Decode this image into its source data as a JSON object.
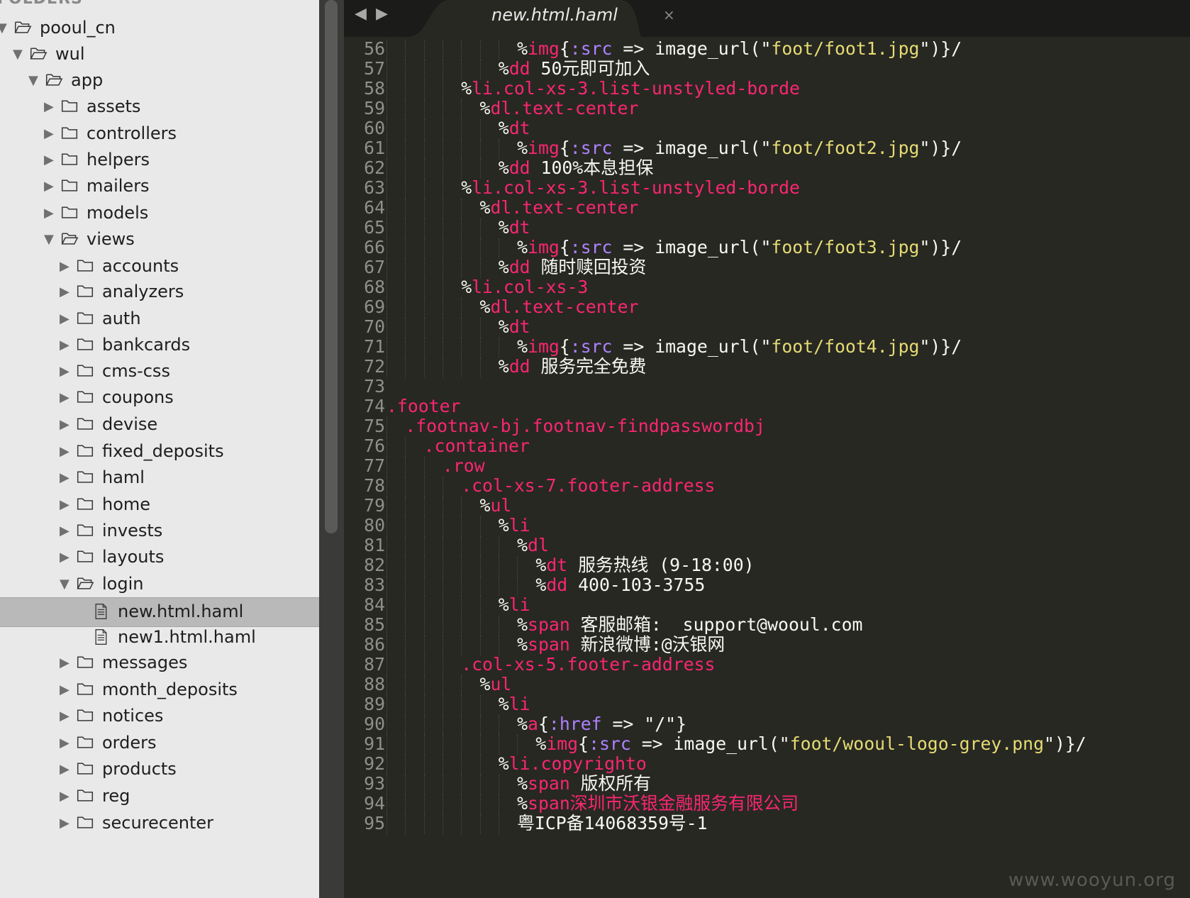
{
  "sidebar": {
    "header": "FOLDERS",
    "items": [
      {
        "label": "pooul_cn",
        "depth": 0,
        "type": "folder",
        "expanded": true
      },
      {
        "label": "wul",
        "depth": 1,
        "type": "folder",
        "expanded": true
      },
      {
        "label": "app",
        "depth": 2,
        "type": "folder",
        "expanded": true
      },
      {
        "label": "assets",
        "depth": 3,
        "type": "folder",
        "expanded": false
      },
      {
        "label": "controllers",
        "depth": 3,
        "type": "folder",
        "expanded": false
      },
      {
        "label": "helpers",
        "depth": 3,
        "type": "folder",
        "expanded": false
      },
      {
        "label": "mailers",
        "depth": 3,
        "type": "folder",
        "expanded": false
      },
      {
        "label": "models",
        "depth": 3,
        "type": "folder",
        "expanded": false
      },
      {
        "label": "views",
        "depth": 3,
        "type": "folder",
        "expanded": true
      },
      {
        "label": "accounts",
        "depth": 4,
        "type": "folder",
        "expanded": false
      },
      {
        "label": "analyzers",
        "depth": 4,
        "type": "folder",
        "expanded": false
      },
      {
        "label": "auth",
        "depth": 4,
        "type": "folder",
        "expanded": false
      },
      {
        "label": "bankcards",
        "depth": 4,
        "type": "folder",
        "expanded": false
      },
      {
        "label": "cms-css",
        "depth": 4,
        "type": "folder",
        "expanded": false
      },
      {
        "label": "coupons",
        "depth": 4,
        "type": "folder",
        "expanded": false
      },
      {
        "label": "devise",
        "depth": 4,
        "type": "folder",
        "expanded": false
      },
      {
        "label": "fixed_deposits",
        "depth": 4,
        "type": "folder",
        "expanded": false
      },
      {
        "label": "haml",
        "depth": 4,
        "type": "folder",
        "expanded": false
      },
      {
        "label": "home",
        "depth": 4,
        "type": "folder",
        "expanded": false
      },
      {
        "label": "invests",
        "depth": 4,
        "type": "folder",
        "expanded": false
      },
      {
        "label": "layouts",
        "depth": 4,
        "type": "folder",
        "expanded": false
      },
      {
        "label": "login",
        "depth": 4,
        "type": "folder",
        "expanded": true
      },
      {
        "label": "new.html.haml",
        "depth": 5,
        "type": "file",
        "selected": true
      },
      {
        "label": "new1.html.haml",
        "depth": 5,
        "type": "file"
      },
      {
        "label": "messages",
        "depth": 4,
        "type": "folder",
        "expanded": false
      },
      {
        "label": "month_deposits",
        "depth": 4,
        "type": "folder",
        "expanded": false
      },
      {
        "label": "notices",
        "depth": 4,
        "type": "folder",
        "expanded": false
      },
      {
        "label": "orders",
        "depth": 4,
        "type": "folder",
        "expanded": false
      },
      {
        "label": "products",
        "depth": 4,
        "type": "folder",
        "expanded": false
      },
      {
        "label": "reg",
        "depth": 4,
        "type": "folder",
        "expanded": false
      },
      {
        "label": "securecenter",
        "depth": 4,
        "type": "folder",
        "expanded": false
      }
    ]
  },
  "editor": {
    "nav_back_icon": "◀",
    "nav_forward_icon": "▶",
    "tab": {
      "title": "new.html.haml",
      "close_icon": "×"
    },
    "colors": {
      "background": "#272822",
      "text": "#f8f8f2",
      "keyword": "#f92672",
      "string": "#e6db74",
      "symbol": "#ae81ff",
      "gutter": "#8f908a"
    },
    "lines": [
      {
        "n": "56",
        "indent": 7,
        "tokens": [
          [
            "p",
            "%"
          ],
          [
            "k",
            "img"
          ],
          [
            "p",
            "{"
          ],
          [
            "s",
            ":src"
          ],
          [
            "p",
            " => image_url(\""
          ],
          [
            "y",
            "foot/foot1.jpg"
          ],
          [
            "p",
            "\")}/"
          ]
        ]
      },
      {
        "n": "57",
        "indent": 6,
        "tokens": [
          [
            "p",
            "%"
          ],
          [
            "k",
            "dd"
          ],
          [
            "p",
            " 50元即可加入"
          ]
        ]
      },
      {
        "n": "58",
        "indent": 4,
        "tokens": [
          [
            "p",
            "%"
          ],
          [
            "k",
            "li.col-xs-3.list-unstyled-borde"
          ]
        ]
      },
      {
        "n": "59",
        "indent": 5,
        "tokens": [
          [
            "p",
            "%"
          ],
          [
            "k",
            "dl.text-center"
          ]
        ]
      },
      {
        "n": "60",
        "indent": 6,
        "tokens": [
          [
            "p",
            "%"
          ],
          [
            "k",
            "dt"
          ]
        ]
      },
      {
        "n": "61",
        "indent": 7,
        "tokens": [
          [
            "p",
            "%"
          ],
          [
            "k",
            "img"
          ],
          [
            "p",
            "{"
          ],
          [
            "s",
            ":src"
          ],
          [
            "p",
            " => image_url(\""
          ],
          [
            "y",
            "foot/foot2.jpg"
          ],
          [
            "p",
            "\")}/"
          ]
        ]
      },
      {
        "n": "62",
        "indent": 6,
        "tokens": [
          [
            "p",
            "%"
          ],
          [
            "k",
            "dd"
          ],
          [
            "p",
            " 100%本息担保"
          ]
        ]
      },
      {
        "n": "63",
        "indent": 4,
        "tokens": [
          [
            "p",
            "%"
          ],
          [
            "k",
            "li.col-xs-3.list-unstyled-borde"
          ]
        ]
      },
      {
        "n": "64",
        "indent": 5,
        "tokens": [
          [
            "p",
            "%"
          ],
          [
            "k",
            "dl.text-center"
          ]
        ]
      },
      {
        "n": "65",
        "indent": 6,
        "tokens": [
          [
            "p",
            "%"
          ],
          [
            "k",
            "dt"
          ]
        ]
      },
      {
        "n": "66",
        "indent": 7,
        "tokens": [
          [
            "p",
            "%"
          ],
          [
            "k",
            "img"
          ],
          [
            "p",
            "{"
          ],
          [
            "s",
            ":src"
          ],
          [
            "p",
            " => image_url(\""
          ],
          [
            "y",
            "foot/foot3.jpg"
          ],
          [
            "p",
            "\")}/"
          ]
        ]
      },
      {
        "n": "67",
        "indent": 6,
        "tokens": [
          [
            "p",
            "%"
          ],
          [
            "k",
            "dd"
          ],
          [
            "p",
            " 随时赎回投资"
          ]
        ]
      },
      {
        "n": "68",
        "indent": 4,
        "tokens": [
          [
            "p",
            "%"
          ],
          [
            "k",
            "li.col-xs-3"
          ]
        ]
      },
      {
        "n": "69",
        "indent": 5,
        "tokens": [
          [
            "p",
            "%"
          ],
          [
            "k",
            "dl.text-center"
          ]
        ]
      },
      {
        "n": "70",
        "indent": 6,
        "tokens": [
          [
            "p",
            "%"
          ],
          [
            "k",
            "dt"
          ]
        ]
      },
      {
        "n": "71",
        "indent": 7,
        "tokens": [
          [
            "p",
            "%"
          ],
          [
            "k",
            "img"
          ],
          [
            "p",
            "{"
          ],
          [
            "s",
            ":src"
          ],
          [
            "p",
            " => image_url(\""
          ],
          [
            "y",
            "foot/foot4.jpg"
          ],
          [
            "p",
            "\")}/"
          ]
        ]
      },
      {
        "n": "72",
        "indent": 6,
        "tokens": [
          [
            "p",
            "%"
          ],
          [
            "k",
            "dd"
          ],
          [
            "p",
            " 服务完全免费"
          ]
        ]
      },
      {
        "n": "73",
        "indent": 0,
        "tokens": []
      },
      {
        "n": "74",
        "indent": 0,
        "tokens": [
          [
            "k",
            ".footer"
          ]
        ]
      },
      {
        "n": "75",
        "indent": 1,
        "tokens": [
          [
            "k",
            ".footnav-bj.footnav-findpasswordbj"
          ]
        ]
      },
      {
        "n": "76",
        "indent": 2,
        "tokens": [
          [
            "k",
            ".container"
          ]
        ]
      },
      {
        "n": "77",
        "indent": 3,
        "tokens": [
          [
            "k",
            ".row"
          ]
        ]
      },
      {
        "n": "78",
        "indent": 4,
        "tokens": [
          [
            "k",
            ".col-xs-7.footer-address"
          ]
        ]
      },
      {
        "n": "79",
        "indent": 5,
        "tokens": [
          [
            "p",
            "%"
          ],
          [
            "k",
            "ul"
          ]
        ]
      },
      {
        "n": "80",
        "indent": 6,
        "tokens": [
          [
            "p",
            "%"
          ],
          [
            "k",
            "li"
          ]
        ]
      },
      {
        "n": "81",
        "indent": 7,
        "tokens": [
          [
            "p",
            "%"
          ],
          [
            "k",
            "dl"
          ]
        ]
      },
      {
        "n": "82",
        "indent": 8,
        "tokens": [
          [
            "p",
            "%"
          ],
          [
            "k",
            "dt"
          ],
          [
            "p",
            " 服务热线 (9-18:00)"
          ]
        ]
      },
      {
        "n": "83",
        "indent": 8,
        "tokens": [
          [
            "p",
            "%"
          ],
          [
            "k",
            "dd"
          ],
          [
            "p",
            " 400-103-3755"
          ]
        ]
      },
      {
        "n": "84",
        "indent": 6,
        "tokens": [
          [
            "p",
            "%"
          ],
          [
            "k",
            "li"
          ]
        ]
      },
      {
        "n": "85",
        "indent": 7,
        "tokens": [
          [
            "p",
            "%"
          ],
          [
            "k",
            "span"
          ],
          [
            "p",
            " 客服邮箱:  support@wooul.com"
          ]
        ]
      },
      {
        "n": "86",
        "indent": 7,
        "tokens": [
          [
            "p",
            "%"
          ],
          [
            "k",
            "span"
          ],
          [
            "p",
            " 新浪微博:@沃银网"
          ]
        ]
      },
      {
        "n": "87",
        "indent": 4,
        "tokens": [
          [
            "k",
            ".col-xs-5.footer-address"
          ]
        ]
      },
      {
        "n": "88",
        "indent": 5,
        "tokens": [
          [
            "p",
            "%"
          ],
          [
            "k",
            "ul"
          ]
        ]
      },
      {
        "n": "89",
        "indent": 6,
        "tokens": [
          [
            "p",
            "%"
          ],
          [
            "k",
            "li"
          ]
        ]
      },
      {
        "n": "90",
        "indent": 7,
        "tokens": [
          [
            "p",
            "%"
          ],
          [
            "k",
            "a"
          ],
          [
            "p",
            "{"
          ],
          [
            "s",
            ":href"
          ],
          [
            "p",
            " => \"/\"}"
          ]
        ]
      },
      {
        "n": "91",
        "indent": 8,
        "tokens": [
          [
            "p",
            "%"
          ],
          [
            "k",
            "img"
          ],
          [
            "p",
            "{"
          ],
          [
            "s",
            ":src"
          ],
          [
            "p",
            " => image_url(\""
          ],
          [
            "y",
            "foot/wooul-logo-grey.png"
          ],
          [
            "p",
            "\")}/"
          ]
        ]
      },
      {
        "n": "92",
        "indent": 6,
        "tokens": [
          [
            "p",
            "%"
          ],
          [
            "k",
            "li.copyrighto"
          ]
        ]
      },
      {
        "n": "93",
        "indent": 7,
        "tokens": [
          [
            "p",
            "%"
          ],
          [
            "k",
            "span"
          ],
          [
            "p",
            " 版权所有"
          ]
        ]
      },
      {
        "n": "94",
        "indent": 7,
        "tokens": [
          [
            "p",
            "%"
          ],
          [
            "k",
            "span深圳市沃银金融服务有限公司"
          ]
        ]
      },
      {
        "n": "95",
        "indent": 7,
        "tokens": [
          [
            "p",
            "粤ICP备14068359号-1"
          ]
        ]
      }
    ]
  },
  "watermark": "www.wooyun.org"
}
